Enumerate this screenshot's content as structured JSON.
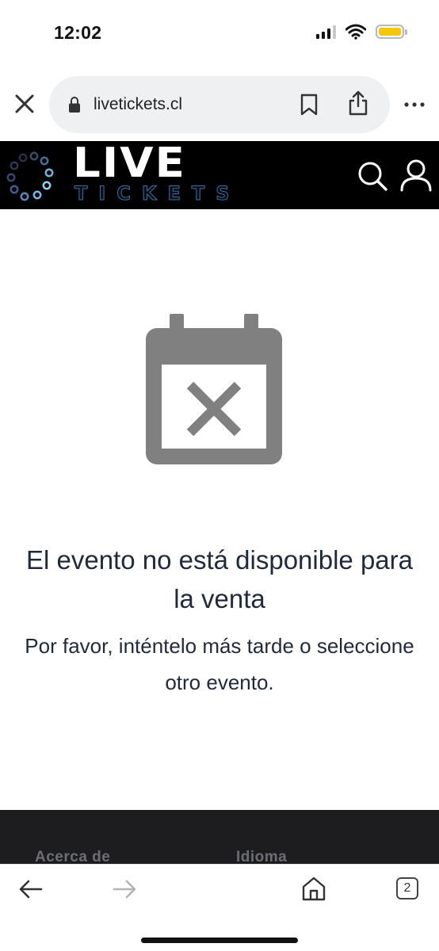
{
  "status_bar": {
    "time": "12:02",
    "icons": [
      "cellular-signal-icon",
      "wifi-icon",
      "battery-icon"
    ],
    "battery_color": "#f6c70c"
  },
  "browser": {
    "url": "livetickets.cl",
    "icons": [
      "close-icon",
      "lock-icon",
      "bookmark-icon",
      "share-icon",
      "more-icon"
    ],
    "tab_count": "2"
  },
  "site_header": {
    "logo_primary": "LIVE",
    "logo_secondary": "TICKETS",
    "icons": [
      "search-icon",
      "user-icon"
    ],
    "background": "#000000"
  },
  "main": {
    "icon": "calendar-cancel-icon",
    "icon_color": "#808081",
    "title": "El evento no está disponible para la venta",
    "message": "Por favor, inténtelo más tarde o seleccione otro evento."
  },
  "footer": {
    "columns": [
      {
        "heading": "Acerca de"
      },
      {
        "heading": "Idioma"
      }
    ]
  },
  "bottom_bar": {
    "icons": [
      "back-arrow-icon",
      "forward-arrow-icon",
      "home-icon",
      "tabs-icon"
    ]
  }
}
